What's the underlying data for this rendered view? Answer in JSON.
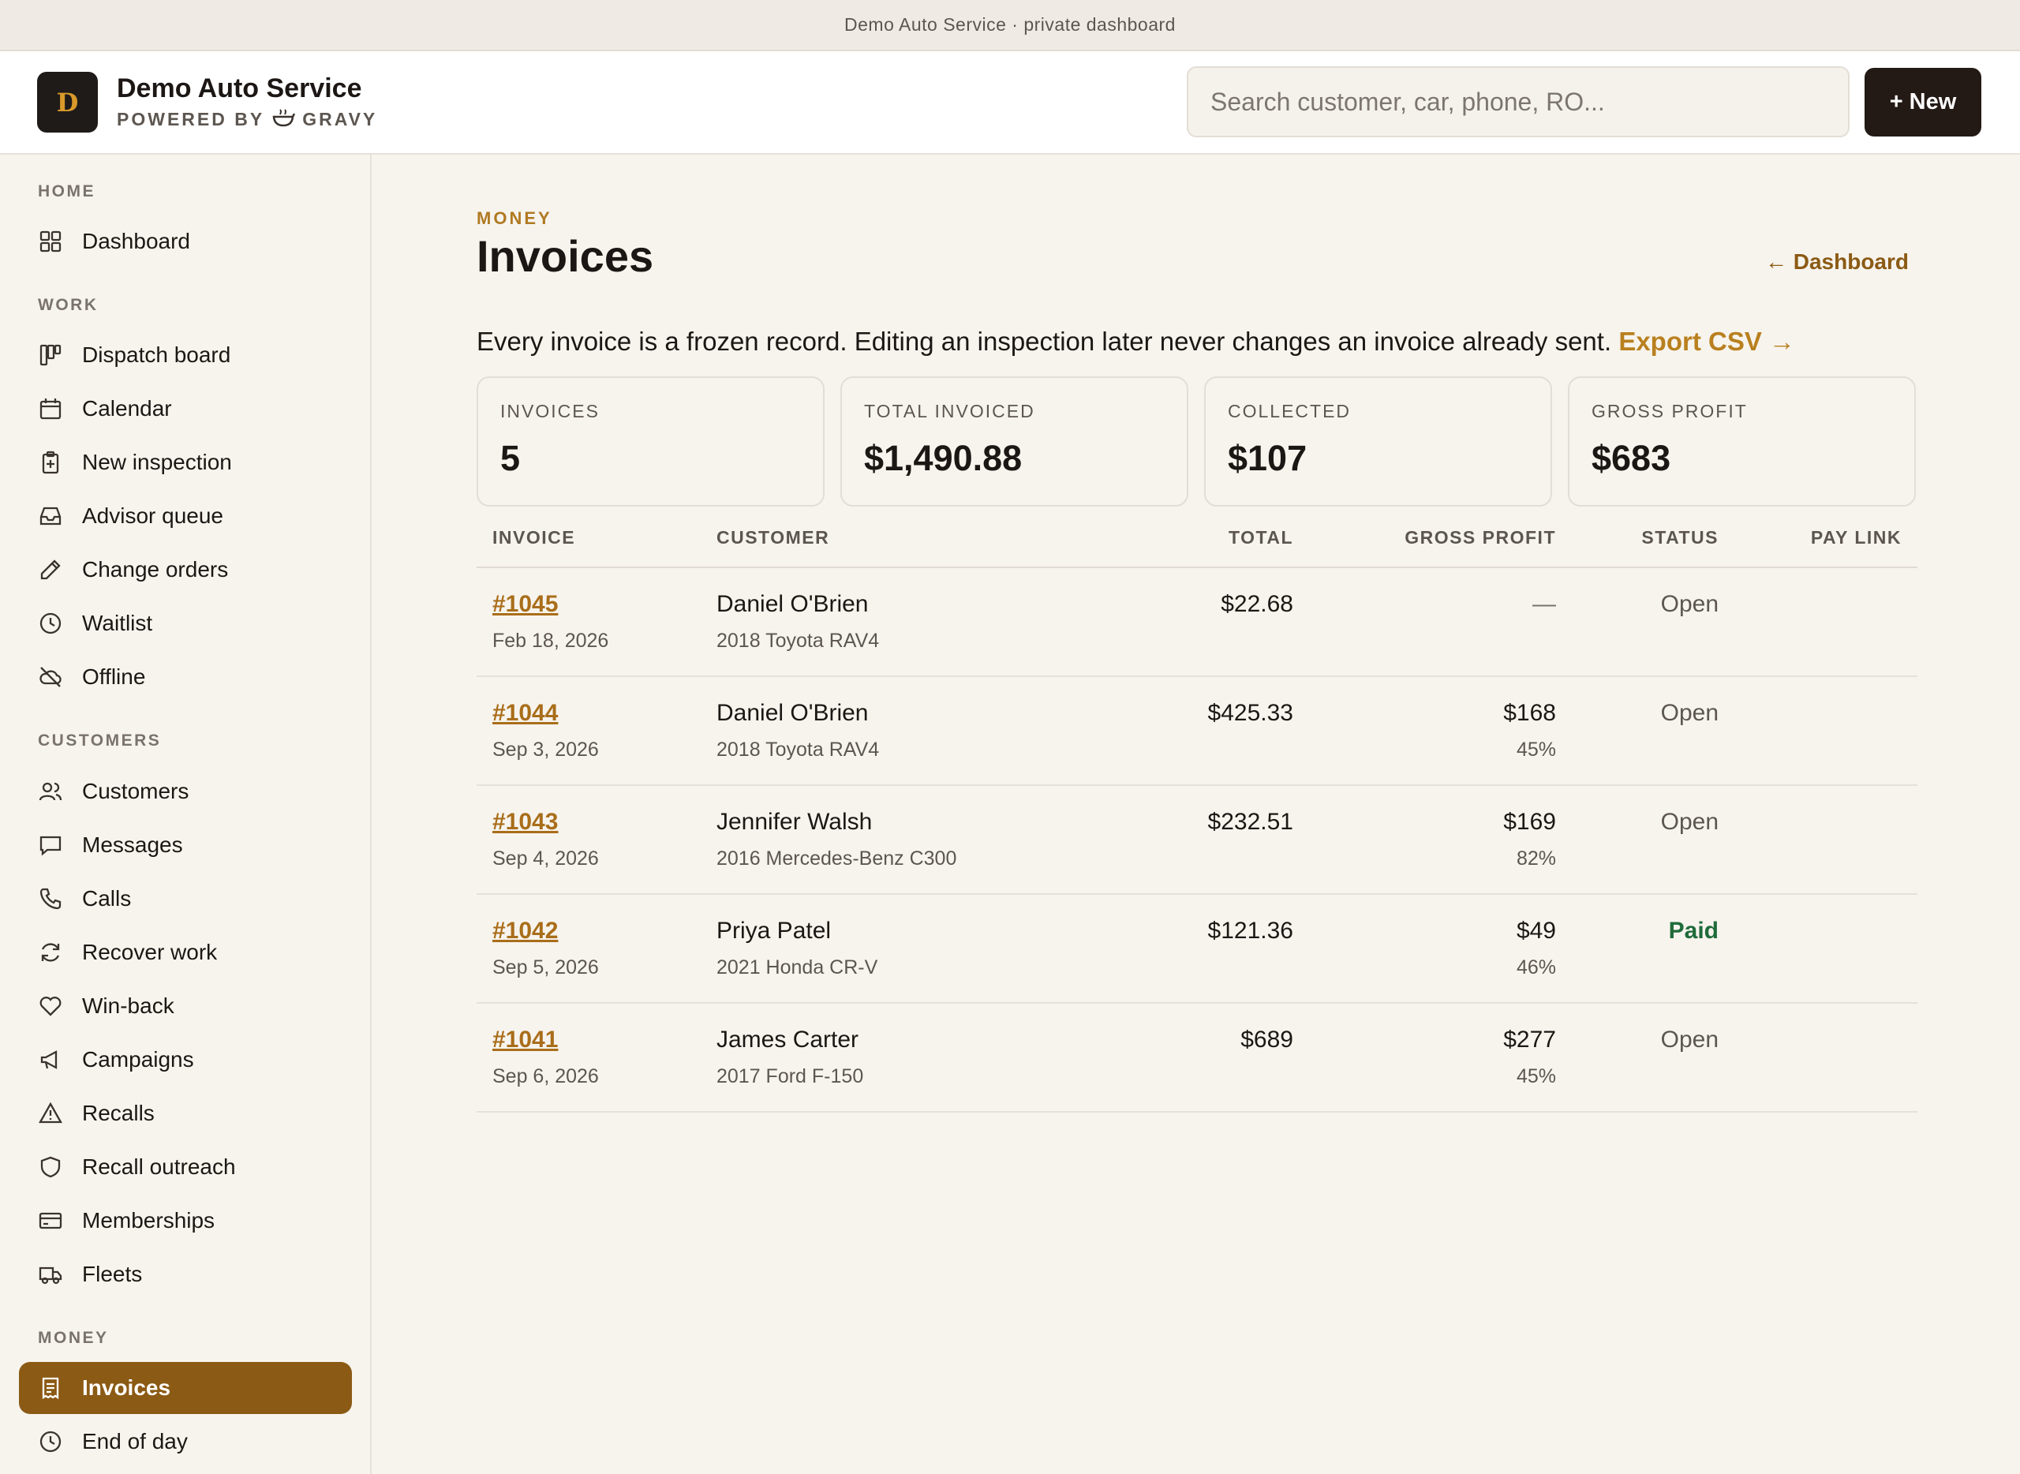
{
  "banner": {
    "text": "Demo Auto Service · private dashboard"
  },
  "header": {
    "logo_letter": "D",
    "brand_name": "Demo Auto Service",
    "brand_sub_prefix": "POWERED BY",
    "brand_sub_name": "GRAVY",
    "search_placeholder": "Search customer, car, phone, RO...",
    "new_button": "+ New"
  },
  "sidebar": {
    "sections": [
      {
        "title": "HOME",
        "items": [
          {
            "label": "Dashboard",
            "icon": "grid-icon"
          }
        ]
      },
      {
        "title": "WORK",
        "items": [
          {
            "label": "Dispatch board",
            "icon": "board-icon"
          },
          {
            "label": "Calendar",
            "icon": "calendar-icon"
          },
          {
            "label": "New inspection",
            "icon": "clipboard-plus-icon"
          },
          {
            "label": "Advisor queue",
            "icon": "inbox-icon"
          },
          {
            "label": "Change orders",
            "icon": "pencil-icon"
          },
          {
            "label": "Waitlist",
            "icon": "clock-icon"
          },
          {
            "label": "Offline",
            "icon": "cloud-off-icon"
          }
        ]
      },
      {
        "title": "CUSTOMERS",
        "items": [
          {
            "label": "Customers",
            "icon": "users-icon"
          },
          {
            "label": "Messages",
            "icon": "message-icon"
          },
          {
            "label": "Calls",
            "icon": "phone-icon"
          },
          {
            "label": "Recover work",
            "icon": "refresh-icon"
          },
          {
            "label": "Win-back",
            "icon": "heart-icon"
          },
          {
            "label": "Campaigns",
            "icon": "megaphone-icon"
          },
          {
            "label": "Recalls",
            "icon": "warning-icon"
          },
          {
            "label": "Recall outreach",
            "icon": "shield-icon"
          },
          {
            "label": "Memberships",
            "icon": "card-icon"
          },
          {
            "label": "Fleets",
            "icon": "truck-icon"
          }
        ]
      },
      {
        "title": "MONEY",
        "items": [
          {
            "label": "Invoices",
            "icon": "receipt-icon",
            "active": true
          },
          {
            "label": "End of day",
            "icon": "clock-icon"
          }
        ]
      }
    ]
  },
  "page": {
    "eyebrow": "MONEY",
    "title": "Invoices",
    "back_link": "← Dashboard",
    "intro": "Every invoice is a frozen record. Editing an inspection later never changes an invoice already sent.",
    "export_link": "Export CSV →"
  },
  "stats": [
    {
      "label": "INVOICES",
      "value": "5"
    },
    {
      "label": "TOTAL INVOICED",
      "value": "$1,490.88"
    },
    {
      "label": "COLLECTED",
      "value": "$107"
    },
    {
      "label": "GROSS PROFIT",
      "value": "$683"
    }
  ],
  "table": {
    "columns": [
      "INVOICE",
      "CUSTOMER",
      "TOTAL",
      "GROSS PROFIT",
      "STATUS",
      "PAY LINK"
    ],
    "rows": [
      {
        "invoice": "#1045",
        "date": "Feb 18, 2026",
        "customer": "Daniel O'Brien",
        "vehicle": "2018 Toyota RAV4",
        "total": "$22.68",
        "gross_profit": "—",
        "margin": "",
        "status": "Open"
      },
      {
        "invoice": "#1044",
        "date": "Sep 3, 2026",
        "customer": "Daniel O'Brien",
        "vehicle": "2018 Toyota RAV4",
        "total": "$425.33",
        "gross_profit": "$168",
        "margin": "45%",
        "status": "Open"
      },
      {
        "invoice": "#1043",
        "date": "Sep 4, 2026",
        "customer": "Jennifer Walsh",
        "vehicle": "2016 Mercedes-Benz C300",
        "total": "$232.51",
        "gross_profit": "$169",
        "margin": "82%",
        "status": "Open"
      },
      {
        "invoice": "#1042",
        "date": "Sep 5, 2026",
        "customer": "Priya Patel",
        "vehicle": "2021 Honda CR-V",
        "total": "$121.36",
        "gross_profit": "$49",
        "margin": "46%",
        "status": "Paid"
      },
      {
        "invoice": "#1041",
        "date": "Sep 6, 2026",
        "customer": "James Carter",
        "vehicle": "2017 Ford F-150",
        "total": "$689",
        "gross_profit": "$277",
        "margin": "45%",
        "status": "Open"
      }
    ]
  },
  "colors": {
    "accent": "#8b5a14",
    "accent_light": "#b9801f",
    "paid": "#1f6b3a",
    "background": "#f7f4ee"
  }
}
